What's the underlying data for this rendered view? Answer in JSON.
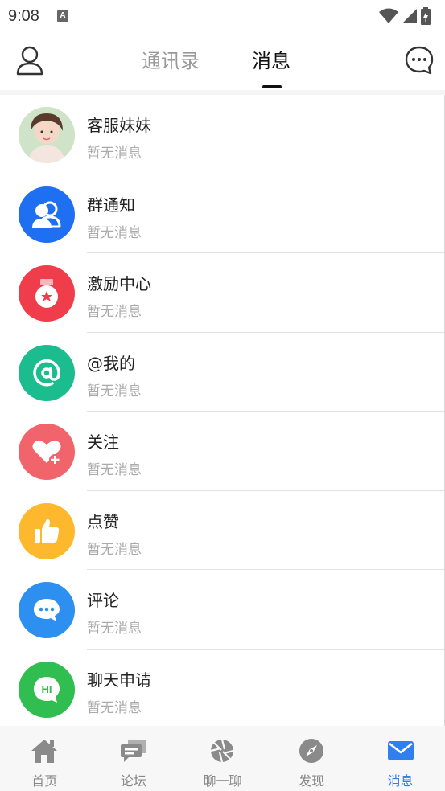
{
  "status_bar": {
    "time": "9:08",
    "notification_icon": "A"
  },
  "header": {
    "tabs": [
      {
        "label": "通讯录",
        "active": false
      },
      {
        "label": "消息",
        "active": true
      }
    ],
    "left_icon": "user-icon",
    "right_icon": "chat-bubble-icon"
  },
  "messages": [
    {
      "title": "客服妹妹",
      "subtitle": "暂无消息",
      "icon": "customer-service-avatar",
      "color": "#f2d6c8"
    },
    {
      "title": "群通知",
      "subtitle": "暂无消息",
      "icon": "group-icon",
      "color": "#1f6ff2"
    },
    {
      "title": "激励中心",
      "subtitle": "暂无消息",
      "icon": "medal-icon",
      "color": "#ef3d4b"
    },
    {
      "title": "@我的",
      "subtitle": "暂无消息",
      "icon": "at-icon",
      "color": "#1bbc8e"
    },
    {
      "title": "关注",
      "subtitle": "暂无消息",
      "icon": "heart-plus-icon",
      "color": "#f2646b"
    },
    {
      "title": "点赞",
      "subtitle": "暂无消息",
      "icon": "thumbs-up-icon",
      "color": "#fdb82d"
    },
    {
      "title": "评论",
      "subtitle": "暂无消息",
      "icon": "comment-icon",
      "color": "#2d8ff0"
    },
    {
      "title": "聊天申请",
      "subtitle": "暂无消息",
      "icon": "hi-bubble-icon",
      "color": "#2fbe4f"
    }
  ],
  "bottom_nav": [
    {
      "label": "首页",
      "icon": "home-icon",
      "active": false
    },
    {
      "label": "论坛",
      "icon": "forum-icon",
      "active": false
    },
    {
      "label": "聊一聊",
      "icon": "aperture-icon",
      "active": false
    },
    {
      "label": "发现",
      "icon": "compass-icon",
      "active": false
    },
    {
      "label": "消息",
      "icon": "mail-icon",
      "active": true
    }
  ],
  "colors": {
    "accent": "#2f7ff0",
    "inactive": "#888888"
  }
}
